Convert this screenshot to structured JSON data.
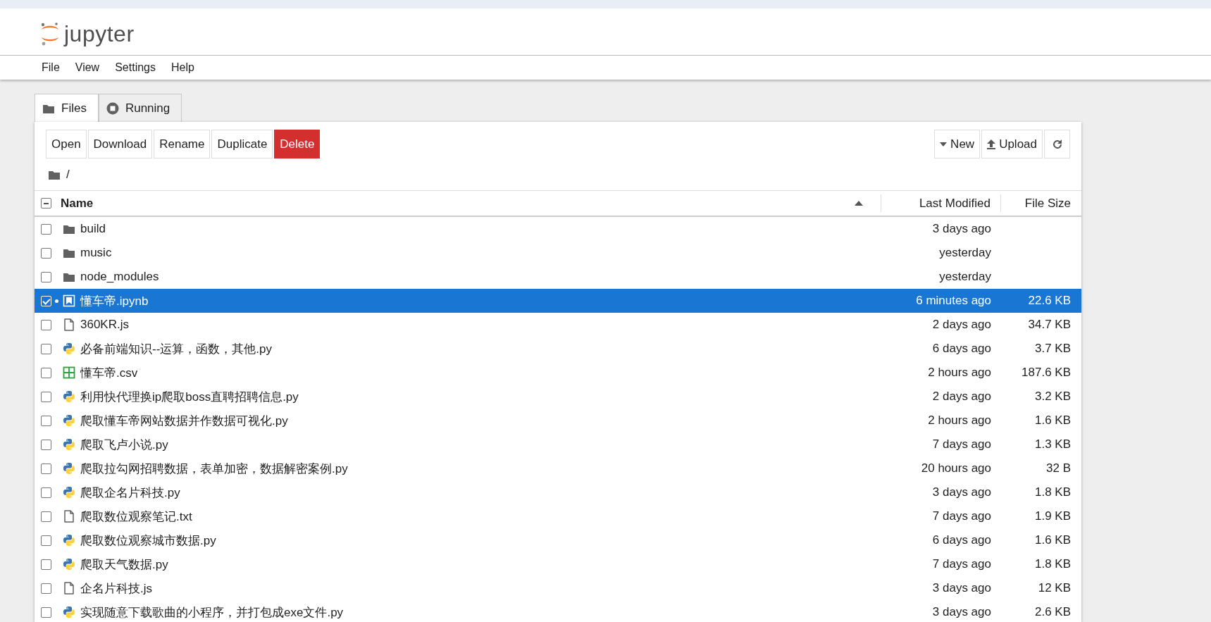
{
  "app": {
    "logo_text": "jupyter"
  },
  "menu": [
    "File",
    "View",
    "Settings",
    "Help"
  ],
  "tabs": [
    {
      "label": "Files",
      "kind": "folder",
      "selected": true
    },
    {
      "label": "Running",
      "kind": "stop",
      "selected": false
    }
  ],
  "toolbar": {
    "actions": [
      {
        "label": "Open",
        "kind": "normal"
      },
      {
        "label": "Download",
        "kind": "normal"
      },
      {
        "label": "Rename",
        "kind": "normal"
      },
      {
        "label": "Duplicate",
        "kind": "normal"
      },
      {
        "label": "Delete",
        "kind": "danger"
      }
    ],
    "new_button": "New",
    "upload_button": "Upload"
  },
  "breadcrumb": "/",
  "table": {
    "select_all": {
      "indeterminate": true
    },
    "columns": [
      {
        "label": "Name",
        "sorted": true
      },
      {
        "label": "Last Modified"
      },
      {
        "label": "File Size"
      }
    ],
    "rows": [
      {
        "name": "build",
        "kind": "folder",
        "modified": "3 days ago",
        "selected": false,
        "running": false
      },
      {
        "name": "music",
        "kind": "folder",
        "modified": "yesterday",
        "selected": false,
        "running": false
      },
      {
        "name": "node_modules",
        "kind": "folder",
        "modified": "yesterday",
        "selected": false,
        "running": false
      },
      {
        "name": "懂车帝.ipynb",
        "kind": "notebook",
        "modified": "6 minutes ago",
        "size": "22.6 KB",
        "selected": true,
        "running": true
      },
      {
        "name": "360KR.js",
        "kind": "file",
        "modified": "2 days ago",
        "size": "34.7 KB",
        "selected": false,
        "running": false
      },
      {
        "name": "必备前端知识--运算，函数，其他.py",
        "kind": "python",
        "modified": "6 days ago",
        "size": "3.7 KB",
        "selected": false,
        "running": false
      },
      {
        "name": "懂车帝.csv",
        "kind": "csv",
        "modified": "2 hours ago",
        "size": "187.6 KB",
        "selected": false,
        "running": false
      },
      {
        "name": "利用快代理换ip爬取boss直聘招聘信息.py",
        "kind": "python",
        "modified": "2 days ago",
        "size": "3.2 KB",
        "selected": false,
        "running": false
      },
      {
        "name": "爬取懂车帝网站数据并作数据可视化.py",
        "kind": "python",
        "modified": "2 hours ago",
        "size": "1.6 KB",
        "selected": false,
        "running": false
      },
      {
        "name": "爬取飞卢小说.py",
        "kind": "python",
        "modified": "7 days ago",
        "size": "1.3 KB",
        "selected": false,
        "running": false
      },
      {
        "name": "爬取拉勾网招聘数据，表单加密，数据解密案例.py",
        "kind": "python",
        "modified": "20 hours ago",
        "size": "32 B",
        "selected": false,
        "running": false
      },
      {
        "name": "爬取企名片科技.py",
        "kind": "python",
        "modified": "3 days ago",
        "size": "1.8 KB",
        "selected": false,
        "running": false
      },
      {
        "name": "爬取数位观察笔记.txt",
        "kind": "file",
        "modified": "7 days ago",
        "size": "1.9 KB",
        "selected": false,
        "running": false
      },
      {
        "name": "爬取数位观察城市数据.py",
        "kind": "python",
        "modified": "6 days ago",
        "size": "1.6 KB",
        "selected": false,
        "running": false
      },
      {
        "name": "爬取天气数据.py",
        "kind": "python",
        "modified": "7 days ago",
        "size": "1.8 KB",
        "selected": false,
        "running": false
      },
      {
        "name": "企名片科技.js",
        "kind": "file",
        "modified": "3 days ago",
        "size": "12 KB",
        "selected": false,
        "running": false
      },
      {
        "name": "实现随意下载歌曲的小程序，并打包成exe文件.py",
        "kind": "python",
        "modified": "3 days ago",
        "size": "2.6 KB",
        "selected": false,
        "running": false
      }
    ]
  }
}
